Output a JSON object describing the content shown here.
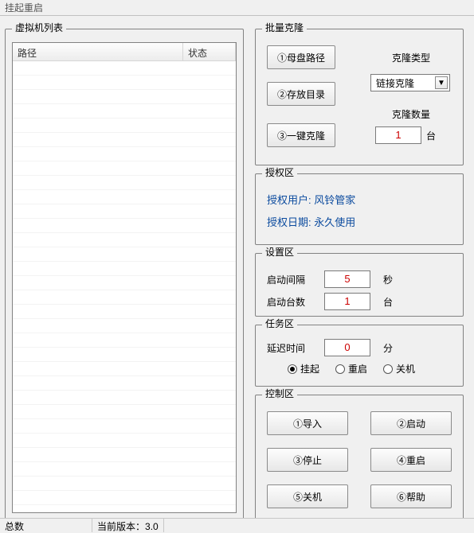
{
  "window": {
    "title": "挂起重启"
  },
  "vmlist": {
    "group_title": "虚拟机列表",
    "col_path": "路径",
    "col_status": "状态"
  },
  "clone": {
    "group_title": "批量克隆",
    "btn_mother": "①母盘路径",
    "btn_dir": "②存放目录",
    "btn_go": "③一键克隆",
    "type_label": "克隆类型",
    "type_selected": "链接克隆",
    "count_label": "克隆数量",
    "count_value": "1",
    "count_unit": "台"
  },
  "auth": {
    "group_title": "授权区",
    "user_label": "授权用户:",
    "user_value": "风铃管家",
    "date_label": "授权日期:",
    "date_value": "永久使用"
  },
  "settings": {
    "group_title": "设置区",
    "interval_label": "启动间隔",
    "interval_value": "5",
    "interval_unit": "秒",
    "count_label": "启动台数",
    "count_value": "1",
    "count_unit": "台"
  },
  "task": {
    "group_title": "任务区",
    "delay_label": "延迟时间",
    "delay_value": "0",
    "delay_unit": "分",
    "radio_suspend": "挂起",
    "radio_restart": "重启",
    "radio_shutdown": "关机",
    "selected": "suspend"
  },
  "control": {
    "group_title": "控制区",
    "btn_import": "①导入",
    "btn_start": "②启动",
    "btn_stop": "③停止",
    "btn_restart": "④重启",
    "btn_shutdown": "⑤关机",
    "btn_help": "⑥帮助"
  },
  "status": {
    "total_label": "总数",
    "version_label": "当前版本：",
    "version_value": "3.0"
  }
}
